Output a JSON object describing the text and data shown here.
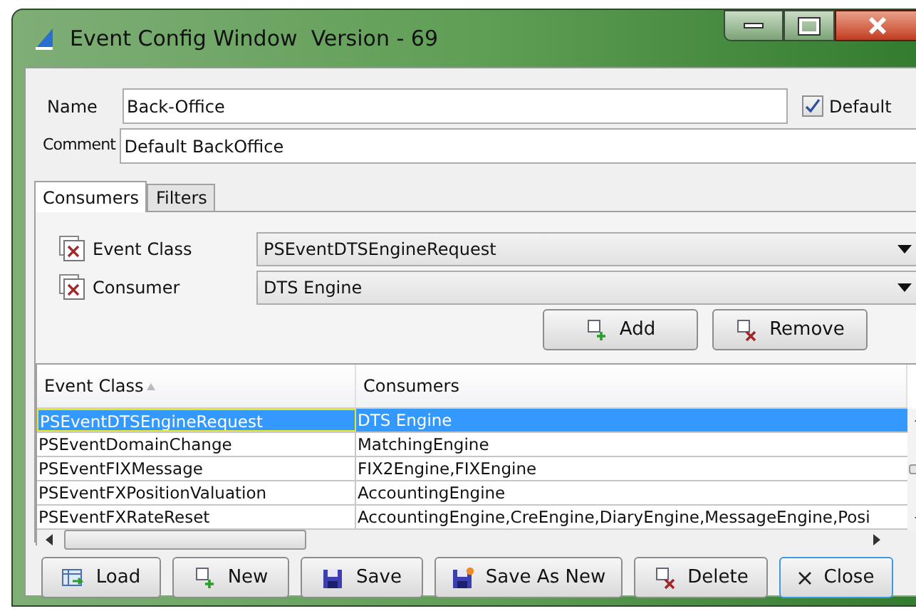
{
  "window": {
    "title": "Event Config Window  Version - 69"
  },
  "form": {
    "name_label": "Name",
    "name_value": "Back-Office",
    "default_label": "Default",
    "default_checked": true,
    "comment_label": "Comment",
    "comment_value": "Default BackOffice"
  },
  "tabs": [
    {
      "label": "Consumers",
      "selected": true
    },
    {
      "label": "Filters",
      "selected": false
    }
  ],
  "selectors": [
    {
      "label": "Event Class",
      "value": "PSEventDTSEngineRequest"
    },
    {
      "label": "Consumer",
      "value": "DTS Engine"
    }
  ],
  "selector_buttons": [
    {
      "kind": "add",
      "label": "Add"
    },
    {
      "kind": "remove",
      "label": "Remove"
    }
  ],
  "table": {
    "columns": [
      "Event Class",
      "Consumers"
    ],
    "rows": [
      {
        "cells": [
          "PSEventDTSEngineRequest",
          "DTS Engine"
        ],
        "selected": true
      },
      {
        "cells": [
          "PSEventDomainChange",
          "MatchingEngine"
        ],
        "selected": false
      },
      {
        "cells": [
          "PSEventFIXMessage",
          "FIX2Engine,FIXEngine"
        ],
        "selected": false
      },
      {
        "cells": [
          "PSEventFXPositionValuation",
          "AccountingEngine"
        ],
        "selected": false
      },
      {
        "cells": [
          "PSEventFXRateReset",
          "AccountingEngine,CreEngine,DiaryEngine,MessageEngine,Posi"
        ],
        "selected": false
      }
    ]
  },
  "buttons": [
    {
      "kind": "load",
      "label": "Load"
    },
    {
      "kind": "new",
      "label": "New"
    },
    {
      "kind": "save",
      "label": "Save"
    },
    {
      "kind": "save_as_new",
      "label": "Save As New"
    },
    {
      "kind": "delete",
      "label": "Delete"
    },
    {
      "kind": "close",
      "label": "Close"
    }
  ]
}
